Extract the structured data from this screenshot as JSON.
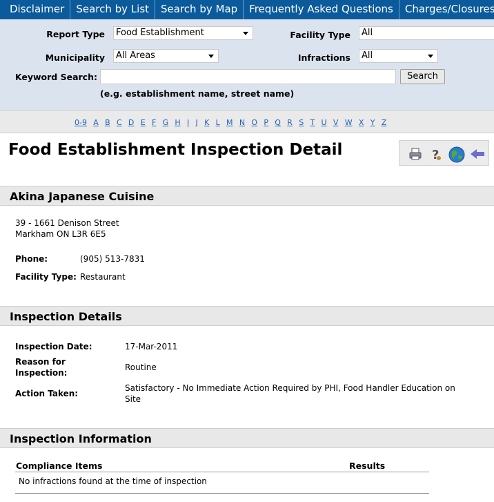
{
  "nav": [
    "Disclaimer",
    "Search by List",
    "Search by Map",
    "Frequently Asked Questions",
    "Charges/Closures"
  ],
  "search": {
    "report_type_label": "Report Type",
    "report_type_value": "Food Establishment",
    "municipality_label": "Municipality",
    "municipality_value": "All Areas",
    "facility_type_label": "Facility Type",
    "facility_type_value": "All",
    "infractions_label": "Infractions",
    "infractions_value": "All",
    "keyword_label": "Keyword Search:",
    "keyword_value": "",
    "search_button": "Search",
    "hint": "(e.g. establishment name, street name)"
  },
  "alphabet": [
    "0-9",
    "A",
    "B",
    "C",
    "D",
    "E",
    "F",
    "G",
    "H",
    "I",
    "J",
    "K",
    "L",
    "M",
    "N",
    "O",
    "P",
    "Q",
    "R",
    "S",
    "T",
    "U",
    "V",
    "W",
    "X",
    "Y",
    "Z"
  ],
  "page_title": "Food Establishment Inspection Detail",
  "toolbar_icons": [
    "printer-icon",
    "help-icon",
    "globe-icon",
    "back-arrow-icon"
  ],
  "establishment": {
    "name": "Akina Japanese Cuisine",
    "address1": "39 - 1661 Denison Street",
    "address2": "Markham ON L3R 6E5",
    "phone_label": "Phone:",
    "phone": "(905) 513-7831",
    "facility_type_label": "Facility Type:",
    "facility_type": "Restaurant"
  },
  "inspection_details": {
    "heading": "Inspection Details",
    "date_label": "Inspection Date:",
    "date": "17-Mar-2011",
    "reason_label_1": "Reason for",
    "reason_label_2": "Inspection:",
    "reason": "Routine",
    "action_label": "Action Taken:",
    "action_line1": "Satisfactory - No Immediate Action Required by PHI, Food Handler Education on",
    "action_line2": "Site"
  },
  "inspection_info": {
    "heading": "Inspection Information",
    "col_items": "Compliance Items",
    "col_results": "Results",
    "row": "No infractions found at the time of inspection"
  },
  "colors": {
    "nav_bg": "#0b5a9c",
    "panel_bg": "#dbe4ee",
    "link": "#1f62b8"
  }
}
